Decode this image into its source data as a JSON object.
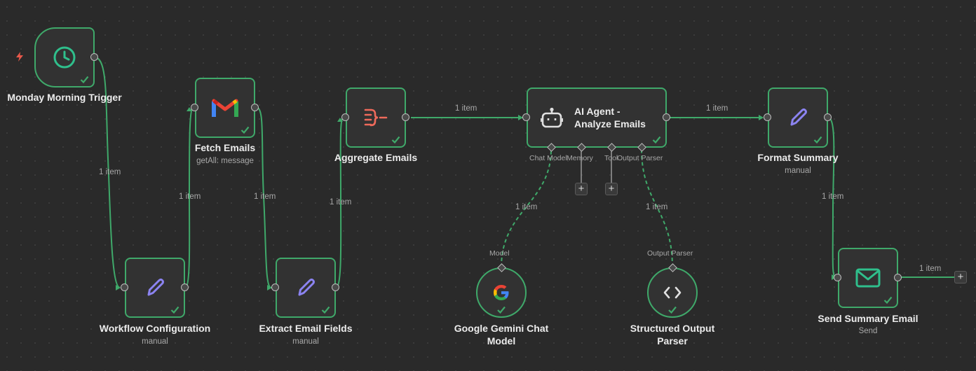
{
  "nodes": {
    "trigger": {
      "label": "Monday Morning Trigger",
      "icon": "clock-icon"
    },
    "config": {
      "label": "Workflow Configuration",
      "sub": "manual",
      "icon": "pencil-icon"
    },
    "fetch": {
      "label": "Fetch Emails",
      "sub": "getAll: message",
      "icon": "gmail-icon"
    },
    "extract": {
      "label": "Extract Email Fields",
      "sub": "manual",
      "icon": "pencil-icon"
    },
    "aggregate": {
      "label": "Aggregate Emails",
      "icon": "aggregate-icon"
    },
    "agent": {
      "label_line1": "AI Agent -",
      "label_line2": "Analyze Emails",
      "icon": "robot-icon"
    },
    "format": {
      "label": "Format Summary",
      "sub": "manual",
      "icon": "pencil-icon"
    },
    "send": {
      "label": "Send Summary Email",
      "sub": "Send",
      "icon": "envelope-icon"
    },
    "gemini": {
      "label_line1": "Google Gemini Chat",
      "label_line2": "Model",
      "icon": "google-icon"
    },
    "parser": {
      "label_line1": "Structured Output",
      "label_line2": "Parser",
      "icon": "code-icon"
    }
  },
  "agent_ports": {
    "chat_model": "Chat Model",
    "memory": "Memory",
    "tool": "Tool",
    "output_parser": "Output Parser"
  },
  "sub_ports": {
    "model": "Model",
    "output_parser": "Output Parser"
  },
  "edge_labels": {
    "trigger_config": "1 item",
    "config_fetch": "1 item",
    "fetch_extract": "1 item",
    "extract_aggregate": "1 item",
    "aggregate_agent": "1 item",
    "agent_format": "1 item",
    "format_send": "1 item",
    "send_out": "1 item",
    "gemini_agent": "1 item",
    "parser_agent": "1 item"
  },
  "plus_label": "+",
  "colors": {
    "canvas": "#2a2a2a",
    "node_fill": "#323232",
    "node_border": "#3fa96a",
    "edge": "#3fa96a",
    "trigger_bolt": "#e8584a",
    "pencil": "#8b83f0",
    "aggregate": "#ef6a5b",
    "envelope": "#2fbf8c"
  }
}
